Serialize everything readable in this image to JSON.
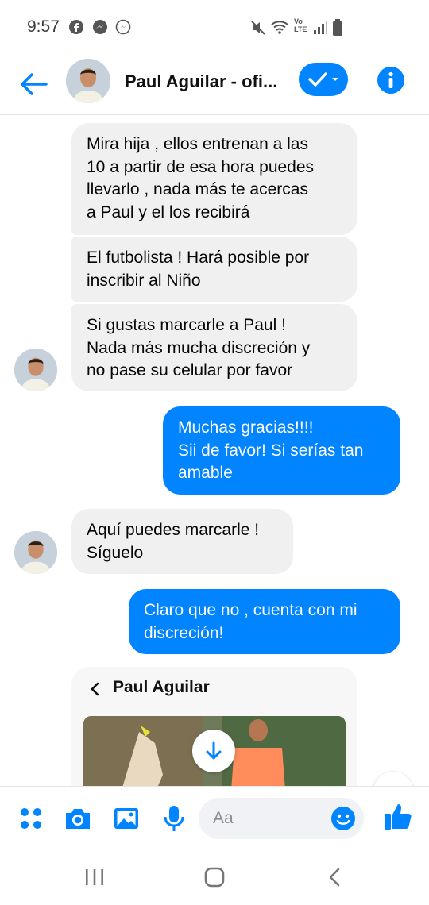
{
  "status": {
    "time": "9:57"
  },
  "header": {
    "title": "Paul Aguilar - ofi..."
  },
  "messages": [
    {
      "side": "in",
      "text": "Mira hija , ellos entrenan a las\n10 a partir de esa hora puedes\nllevarlo , nada más te acercas\na Paul y el los recibirá"
    },
    {
      "side": "in",
      "text": "El futbolista ! Hará posible por\ninscribir al Niño"
    },
    {
      "side": "in",
      "text": "Si gustas marcarle a Paul !\nNada más mucha discreción y\nno pase su celular por favor"
    },
    {
      "side": "out",
      "text": "Muchas gracias!!!!\nSii de favor! Si serías tan\namable"
    },
    {
      "side": "in",
      "text": "Aquí puedes marcarle !\nSíguelo"
    },
    {
      "side": "out",
      "text": "Claro que no , cuenta con mi\ndiscreción!"
    }
  ],
  "shared_card": {
    "title": "Paul Aguilar"
  },
  "composer": {
    "placeholder": "Aa"
  },
  "colors": {
    "accent": "#0084ff",
    "incoming_bubble": "#f0f0f0"
  },
  "icons": [
    "back-arrow-icon",
    "verified-check-icon",
    "info-icon",
    "apps-icon",
    "camera-icon",
    "gallery-icon",
    "microphone-icon",
    "emoji-icon",
    "thumbs-up-icon",
    "download-icon"
  ]
}
